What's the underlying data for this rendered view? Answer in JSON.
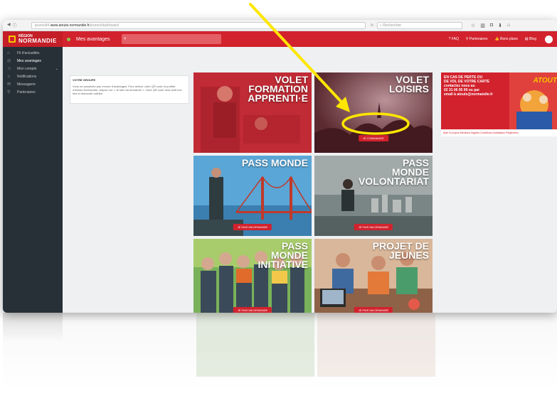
{
  "browser": {
    "url_prefix": "jeunes84.",
    "url_host": "www.atouts.normandie.fr",
    "url_path": "/jeunes/dashboard",
    "search_placeholder": "Rechercher"
  },
  "app": {
    "brand_small": "RÉGION",
    "brand_big": "NORMANDIE",
    "title": "Mes avantages"
  },
  "topnav": [
    {
      "label": "FAQ",
      "icon": "help-icon"
    },
    {
      "label": "Partenaires",
      "icon": "map-pin-icon"
    },
    {
      "label": "Bons plans",
      "icon": "thumbs-up-icon"
    },
    {
      "label": "Blog",
      "icon": "blog-icon"
    }
  ],
  "sidebar": [
    {
      "label": "Fil d'actualités",
      "icon": "home-icon"
    },
    {
      "label": "Mes avantages",
      "icon": "gift-icon"
    },
    {
      "label": "Mon compte",
      "icon": "user-icon"
    },
    {
      "label": "Notifications",
      "icon": "bell-icon"
    },
    {
      "label": "Messagerie",
      "icon": "mail-icon"
    },
    {
      "label": "Partenaires",
      "icon": "pin-icon"
    }
  ],
  "infocard": {
    "title": "VOTRE GROUPE",
    "text": "Vous ne possédez pas encore d'avantages. Pour activer votre QR code et profiter d'Atouts Normandie, cliquez sur « Je fais ma demande ». Votre QR code sera actif une fois la demande validée."
  },
  "tiles": [
    {
      "title": [
        "VOLET",
        "FORMATION",
        "APPRENTI·E"
      ],
      "button": "",
      "color": "#c0392b"
    },
    {
      "title": [
        "VOLET",
        "LOISIRS"
      ],
      "button": "JE COMMANDE",
      "color": "#6e2a2e"
    },
    {
      "title": [
        "PASS MONDE"
      ],
      "button": "JE FAIS MA DEMANDE",
      "color": "#2f7fb5"
    },
    {
      "title": [
        "PASS",
        "MONDE",
        "VOLONTARIAT"
      ],
      "button": "JE FAIS MA DEMANDE",
      "color": "#7d8a8e"
    },
    {
      "title": [
        "PASS",
        "MONDE",
        "INITIATIVE"
      ],
      "button": "JE FAIS MA DEMANDE",
      "color": "#5a8f3d"
    },
    {
      "title": [
        "PROJET DE",
        "JEUNES"
      ],
      "button": "JE FAIS MA DEMANDE",
      "color": "#b7886a"
    }
  ],
  "promo": {
    "lines": [
      "EN CAS DE PERTE OU",
      "DE VOL DE VOTRE CARTE",
      "contactez nous au",
      "02 31 06 95 99 ou par",
      "email à atouts@normandie.fr"
    ],
    "logo": "ATOUT",
    "footer": "Aide À propos Mentions légales Conditions d'utilisation Règlement"
  }
}
